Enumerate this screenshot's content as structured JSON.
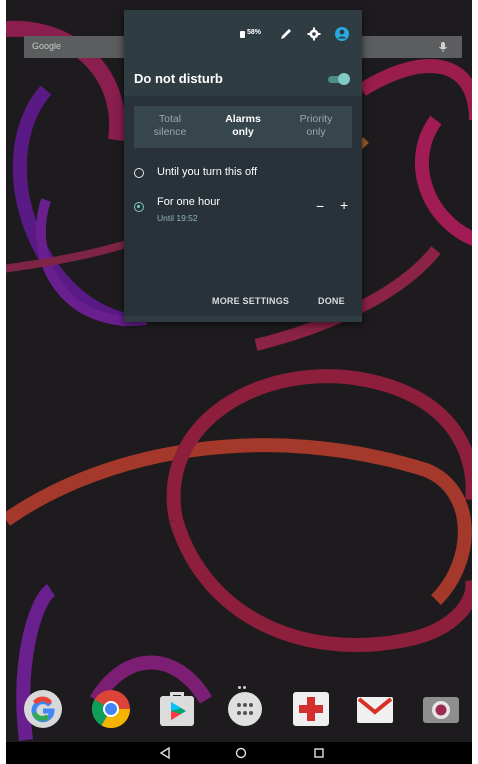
{
  "status_bar": {
    "battery_text": "58%",
    "icons": [
      "battery-icon",
      "pencil-icon",
      "gear-icon",
      "account-icon"
    ]
  },
  "search": {
    "label": "Google",
    "icon": "mic-icon"
  },
  "dnd": {
    "title": "Do not disturb",
    "enabled": true,
    "modes": [
      {
        "line1": "Total",
        "line2": "silence",
        "selected": false
      },
      {
        "line1": "Alarms",
        "line2": "only",
        "selected": true
      },
      {
        "line1": "Priority",
        "line2": "only",
        "selected": false
      }
    ],
    "options": [
      {
        "label": "Until you turn this off",
        "selected": false
      },
      {
        "label": "For one hour",
        "sublabel": "Until 19:52",
        "selected": true
      }
    ],
    "stepper": {
      "minus": "−",
      "plus": "+"
    },
    "actions": {
      "more": "MORE SETTINGS",
      "done": "DONE"
    }
  },
  "dock": {
    "apps": [
      "google-app-icon",
      "chrome-icon",
      "play-store-icon",
      "app-drawer-icon",
      "health-app-icon",
      "gmail-icon",
      "camera-app-icon"
    ]
  },
  "nav": {
    "buttons": [
      "back-icon",
      "home-icon",
      "recents-icon"
    ]
  },
  "colors": {
    "panel": "#2f3c42",
    "accent": "#80cbc4",
    "wallpaper": "#1d1b1e"
  }
}
